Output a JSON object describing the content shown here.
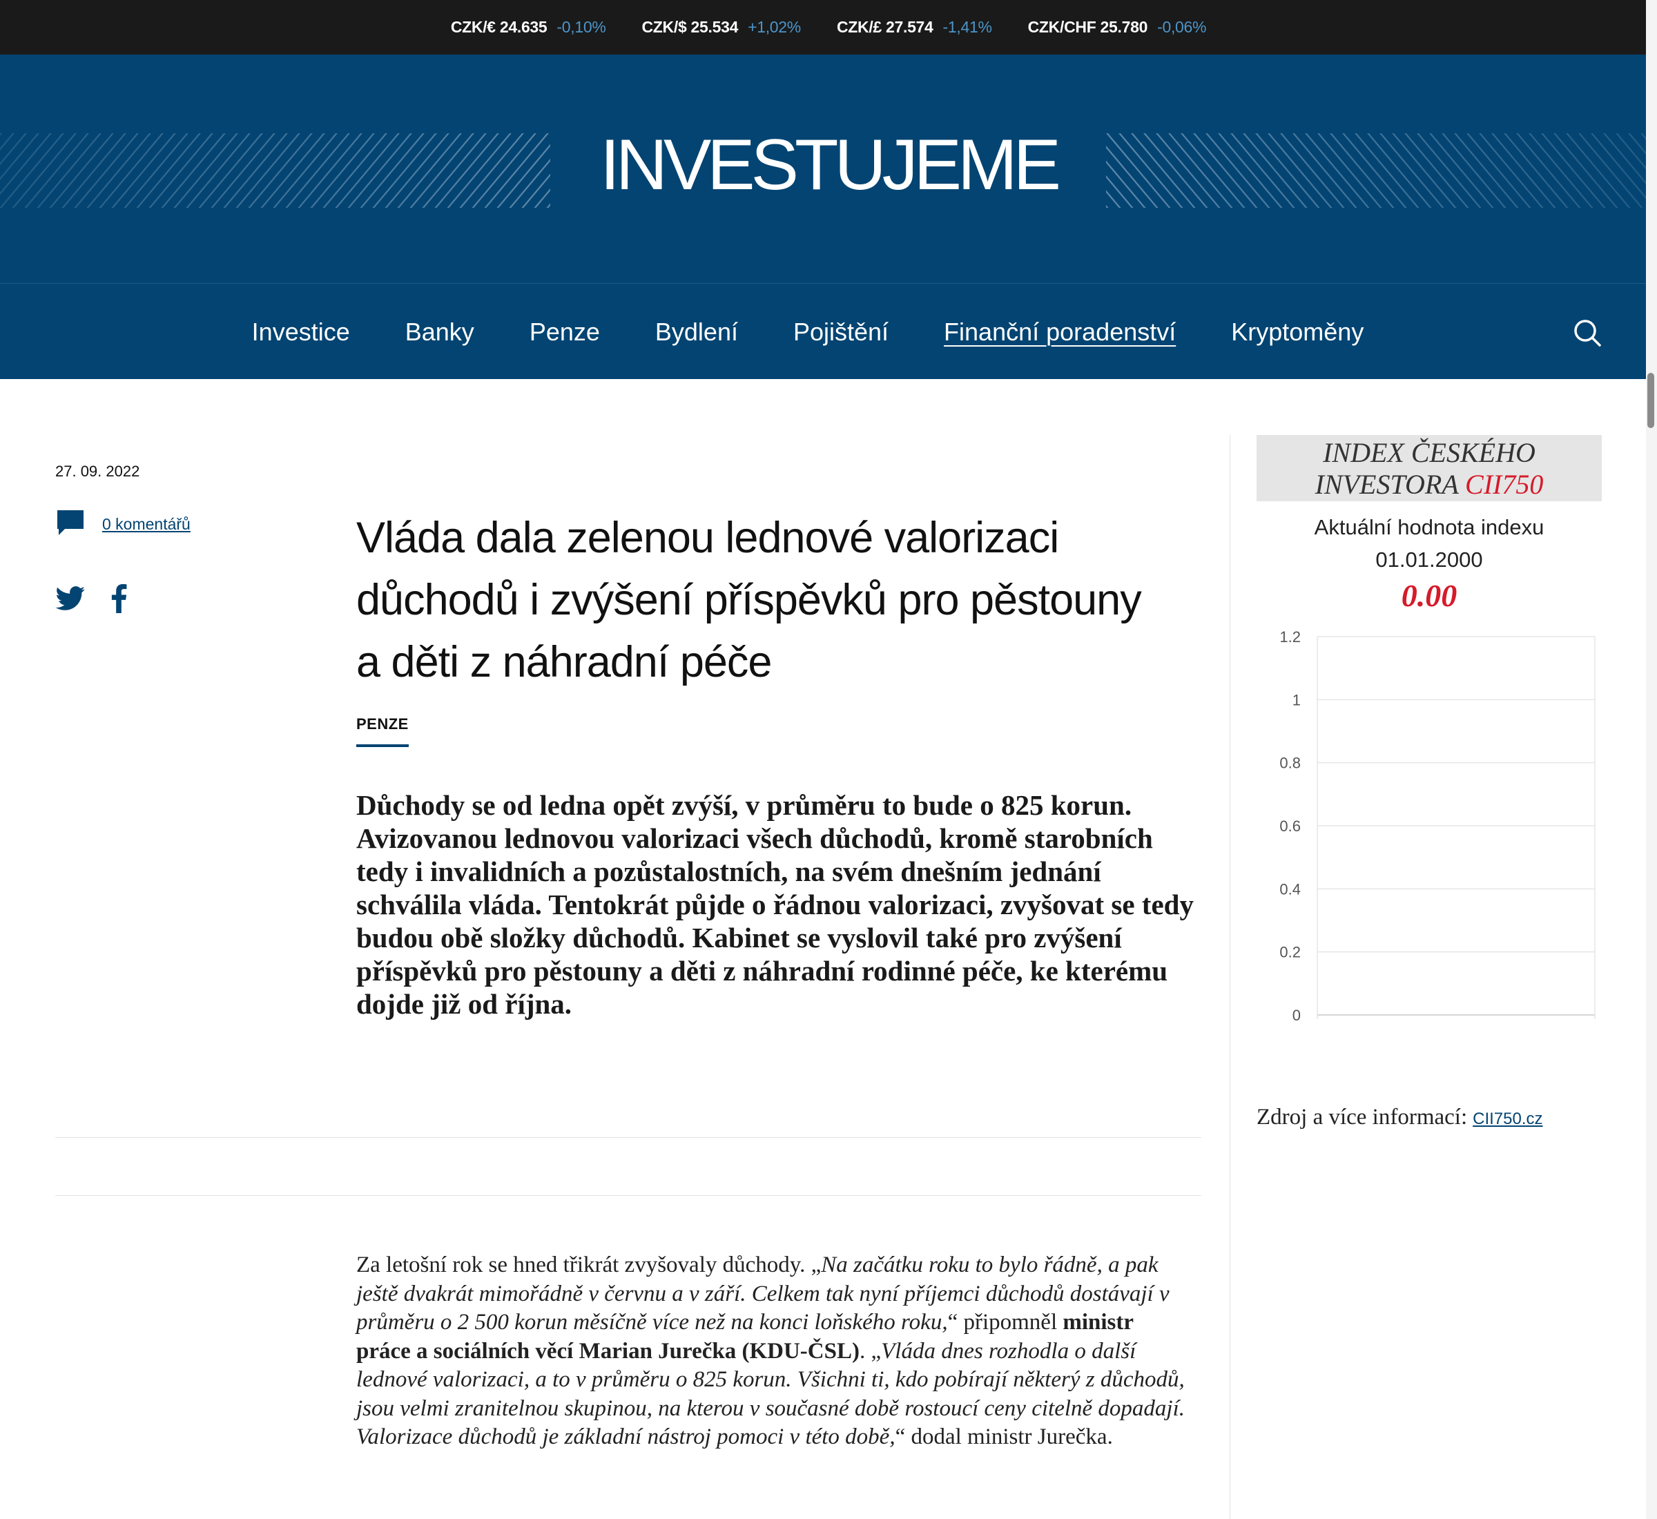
{
  "ticker": [
    {
      "pair": "CZK/€ 24.635",
      "change": "-0,10%"
    },
    {
      "pair": "CZK/$ 25.534",
      "change": "+1,02%"
    },
    {
      "pair": "CZK/£ 27.574",
      "change": "-1,41%"
    },
    {
      "pair": "CZK/CHF 25.780",
      "change": "-0,06%"
    }
  ],
  "header": {
    "logo": "INVESTUJEME"
  },
  "nav": {
    "items": [
      "Investice",
      "Banky",
      "Penze",
      "Bydlení",
      "Pojištění",
      "Finanční poradenství",
      "Kryptoměny"
    ],
    "active_index": 5,
    "search_icon": "search-icon"
  },
  "article": {
    "date": "27. 09. 2022",
    "comments_label": "0 komentářů",
    "share_icons": [
      "twitter-icon",
      "facebook-icon"
    ],
    "title": "Vláda dala zelenou lednové valorizaci důchodů i zvýšení příspěvků pro pěstouny a děti z náhradní péče",
    "category": "PENZE",
    "perex": "Důchody se od ledna opět zvýší, v průměru to bude o 825 korun. Avizovanou lednovou valorizaci všech důchodů, kromě starobních tedy i invalidních a pozůstalostních, na svém dnešním jednání schválila vláda. Tentokrát půjde o řádnou valorizaci, zvyšovat se tedy budou obě složky důchodů. Kabinet se vyslovil také pro zvýšení příspěvků pro pěstouny a děti z náhradní rodinné péče, ke kterému dojde již od října.",
    "body": {
      "p1": "Za letošní rok se hned třikrát zvyšovaly důchody. „",
      "q1": "Na začátku roku to bylo řádně, a pak ještě dvakrát mimořádně v červnu a v září. Celkem tak nyní příjemci důchodů dostávají v průměru o 2 500 korun měsíčně více než na konci loňského roku,",
      "p2": "“ připomněl ",
      "b1": "ministr práce a sociálních věcí Marian Jurečka (KDU-ČSL)",
      "p3": ". „",
      "q2": "Vláda dnes rozhodla o další lednové valorizaci, a to v průměru o 825 korun. Všichni ti, kdo pobírají některý z důchodů, jsou velmi zranitelnou skupinou, na kterou v současné době rostoucí ceny citelně dopadají. Valorizace důchodů je základní nástroj pomoci v této době,",
      "p4": "“ dodal ministr Jurečka."
    }
  },
  "sidebar": {
    "index_title_1": "INDEX ČESKÉHO",
    "index_title_2": "INVESTORA",
    "index_code": "CII750",
    "subtitle": "Aktuální hodnota indexu",
    "date": "01.01.2000",
    "value": "0.00",
    "source_label": "Zdroj a více informací:",
    "source_link": "CII750.cz"
  },
  "colors": {
    "brand": "#034472",
    "ticker_bg": "#1a1a1a",
    "ticker_change": "#4d95c9",
    "index_red": "#d51b2a"
  },
  "chart_data": {
    "type": "line",
    "x": [],
    "series": [
      {
        "values": []
      }
    ],
    "ylim": [
      0,
      1.2
    ],
    "yticks": [
      "1.2",
      "1",
      "0.8",
      "0.6",
      "0.4",
      "0.2",
      "0"
    ],
    "grid": true
  }
}
